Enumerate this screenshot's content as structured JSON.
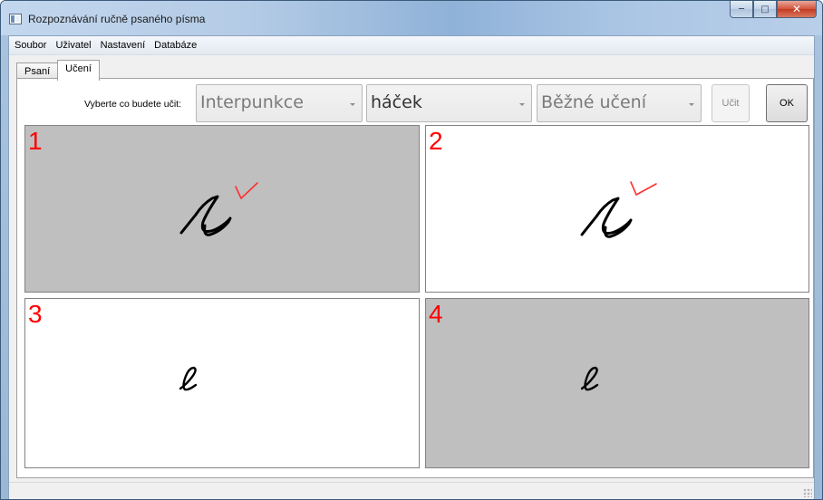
{
  "window": {
    "title": "Rozpoznávání ručně psaného písma"
  },
  "menu": {
    "items": [
      "Soubor",
      "Uživatel",
      "Nastavení",
      "Databáze"
    ]
  },
  "tabs": [
    {
      "label": "Psaní",
      "active": false
    },
    {
      "label": "Učení",
      "active": true
    }
  ],
  "toolbar": {
    "prompt": "Vyberte co budete učit:",
    "category": "Interpunkce",
    "symbol": "háček",
    "mode": "Běžné učení",
    "teach_label": "Učit",
    "ok_label": "OK"
  },
  "samples": [
    {
      "number": "1",
      "background": "gray",
      "content": "handwritten s with red hacek"
    },
    {
      "number": "2",
      "background": "white",
      "content": "handwritten s with red hacek"
    },
    {
      "number": "3",
      "background": "white",
      "content": "handwritten l"
    },
    {
      "number": "4",
      "background": "gray",
      "content": "handwritten l"
    }
  ],
  "colors": {
    "accent": "#ff0000",
    "stroke": "#000000",
    "cell_gray": "#bfbfbf"
  }
}
